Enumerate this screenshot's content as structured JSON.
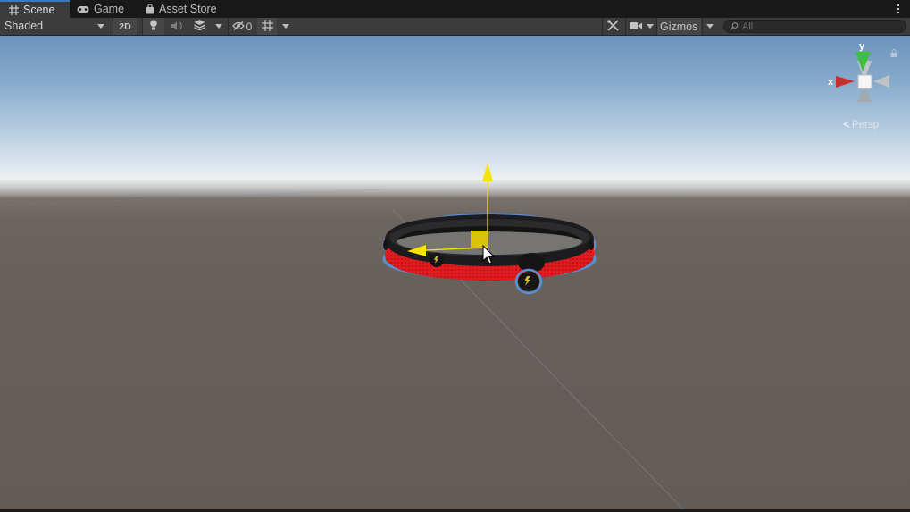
{
  "tabs": [
    {
      "label": "Scene",
      "icon": "grid-icon",
      "active": true
    },
    {
      "label": "Game",
      "icon": "gamepad-icon",
      "active": false
    },
    {
      "label": "Asset Store",
      "icon": "shopping-bag-icon",
      "active": false
    }
  ],
  "toolbar": {
    "draw_mode": "Shaded",
    "toggle_2d": "2D",
    "hidden_count": "0",
    "gizmos_label": "Gizmos",
    "search_placeholder": "All"
  },
  "viewport": {
    "gizmo_axes": {
      "x": "x",
      "y": "y"
    },
    "projection_label": "Persp"
  },
  "colors": {
    "accent": "#3a79bb",
    "selection_outline": "#5b8fd4",
    "move_handle": "#f4e400",
    "axis_x": "#d03030",
    "axis_y": "#3fbf3f",
    "object_red": "#e0191c"
  }
}
